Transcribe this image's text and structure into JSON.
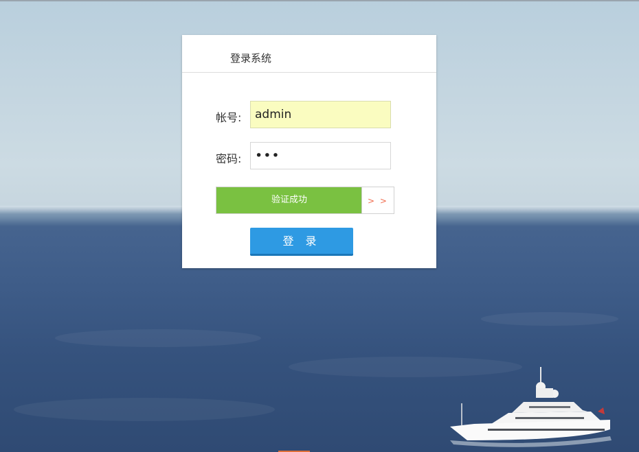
{
  "login": {
    "title": "登录系统",
    "username_label": "帐号:",
    "username_value": "admin",
    "password_label": "密码:",
    "password_value": "•••",
    "slider_text": "验证成功",
    "slider_handle": "> >",
    "login_button": "登 录"
  },
  "colors": {
    "slider_success": "#7ac141",
    "login_button": "#2e9ae3",
    "username_fill": "#fafcc0",
    "handle_arrow": "#f06c4e"
  },
  "icons": {
    "background": "sea-yacht-photo"
  }
}
